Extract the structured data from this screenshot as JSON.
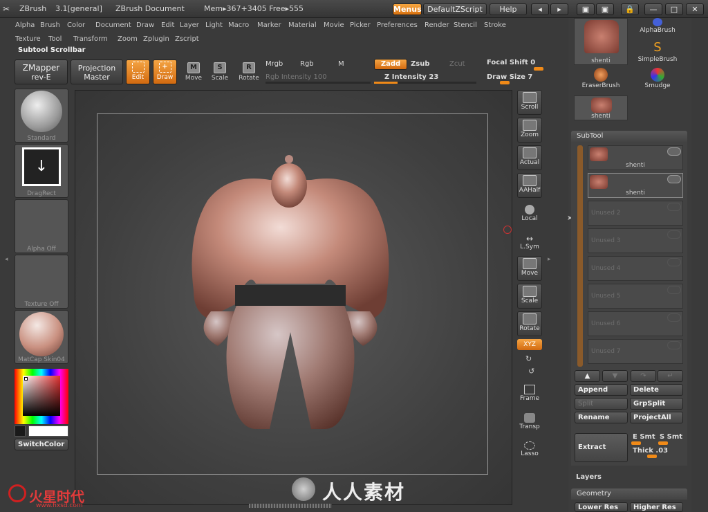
{
  "titlebar": {
    "app": "ZBrush",
    "version": "3.1[general]",
    "document": "ZBrush Document",
    "mem": "Mem▸367+3405 Free▸555",
    "menus_btn": "Menus",
    "script_btn": "DefaultZScript",
    "help_btn": "Help"
  },
  "menu_row1": [
    "Alpha",
    "Brush",
    "Color",
    "Document",
    "Draw",
    "Edit",
    "Layer",
    "Light",
    "Macro",
    "Marker",
    "Material",
    "Movie",
    "Picker",
    "Preferences",
    "Render",
    "Stencil",
    "Stroke"
  ],
  "menu_row2": [
    "Texture",
    "Tool",
    "Transform",
    "Zoom",
    "Zplugin",
    "Zscript"
  ],
  "scrollbar_title": "Subtool Scrollbar",
  "toolbar": {
    "zmapper_line1": "ZMapper",
    "zmapper_line2": "rev-E",
    "projection_line1": "Projection",
    "projection_line2": "Master",
    "edit": "Edit",
    "draw": "Draw",
    "move": "Move",
    "scale": "Scale",
    "rotate": "Rotate",
    "mrgb": "Mrgb",
    "rgb": "Rgb",
    "m": "M",
    "zadd": "Zadd",
    "zsub": "Zsub",
    "zcut": "Zcut",
    "rgb_intensity": "Rgb Intensity 100",
    "z_intensity": "Z Intensity 23",
    "focal_shift": "Focal Shift 0",
    "draw_size": "Draw Size 7",
    "z_intensity_level": 0.23
  },
  "left_shelf": {
    "standard": "Standard",
    "dragrect": "DragRect",
    "alpha": "Alpha Off",
    "texture": "Texture Off",
    "matcap": "MatCap Skin04",
    "switchcolor": "SwitchColor"
  },
  "right_toolbar": [
    "Scroll",
    "Zoom",
    "Actual",
    "AAHalf",
    "Local",
    "L.Sym",
    "Move",
    "Scale",
    "Rotate",
    "XYZ",
    "Frame",
    "Transp",
    "Lasso"
  ],
  "brush_palette": {
    "items": [
      "shenti",
      "AlphaBrush",
      "SimpleBrush",
      "EraserBrush",
      "Smudge",
      "shenti"
    ]
  },
  "subtool": {
    "title": "SubTool",
    "slots": [
      {
        "label": "shenti"
      },
      {
        "label": "shenti"
      },
      {
        "label": "Unused 2"
      },
      {
        "label": "Unused 3"
      },
      {
        "label": "Unused 4"
      },
      {
        "label": "Unused 5"
      },
      {
        "label": "Unused 6"
      },
      {
        "label": "Unused 7"
      }
    ],
    "append": "Append",
    "delete": "Delete",
    "split": "Split",
    "grpsplit": "GrpSplit",
    "rename": "Rename",
    "projectall": "ProjectAll",
    "extract": "Extract",
    "e_smt": "E Smt",
    "s_smt": "S Smt",
    "thick": "Thick .03"
  },
  "panels": {
    "layers": "Layers",
    "geometry": "Geometry",
    "lower_res": "Lower Res",
    "higher_res": "Higher Res"
  },
  "watermark": {
    "left": "火星时代",
    "left_url": "www.hxsd.com",
    "center": "人人素材"
  },
  "colors": {
    "accent": "#f08a18",
    "model": "#b77b6c"
  }
}
